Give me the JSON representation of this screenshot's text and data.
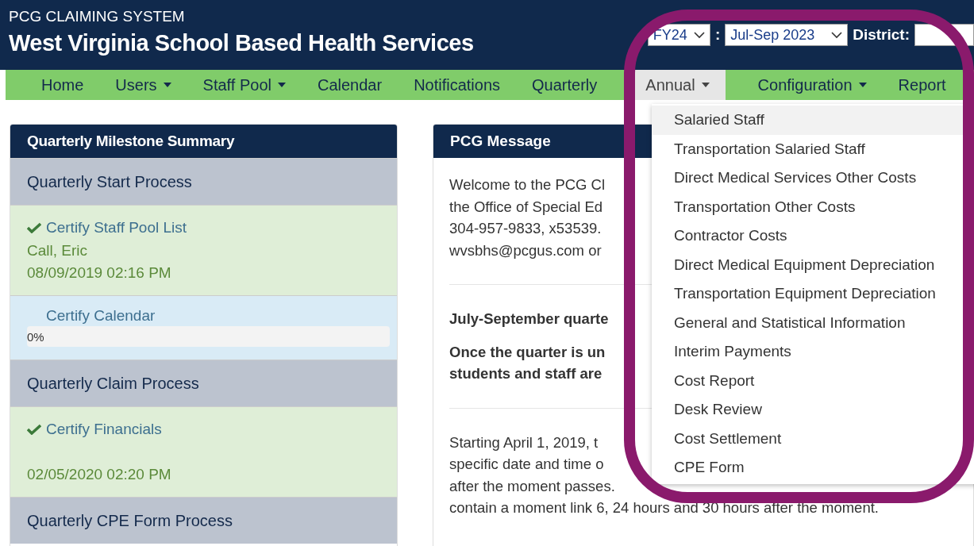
{
  "header": {
    "system": "PCG CLAIMING SYSTEM",
    "title": "West Virginia School Based Health Services",
    "fiscal_year": "FY24",
    "separator": ":",
    "quarter": "Jul-Sep 2023",
    "district_label": "District:"
  },
  "nav": [
    {
      "label": "Home",
      "has_menu": false,
      "selected": false
    },
    {
      "label": "Users",
      "has_menu": true,
      "selected": false
    },
    {
      "label": "Staff Pool",
      "has_menu": true,
      "selected": false
    },
    {
      "label": "Calendar",
      "has_menu": false,
      "selected": false
    },
    {
      "label": "Notifications",
      "has_menu": false,
      "selected": false
    },
    {
      "label": "Quarterly",
      "has_menu": false,
      "selected": false
    },
    {
      "label": "Annual",
      "has_menu": true,
      "selected": true
    },
    {
      "label": "Configuration",
      "has_menu": true,
      "selected": false
    },
    {
      "label": "Report",
      "has_menu": false,
      "selected": false
    }
  ],
  "annual_menu": [
    {
      "label": "Salaried Staff",
      "selected": true
    },
    {
      "label": "Transportation Salaried Staff",
      "selected": false
    },
    {
      "label": "Direct Medical Services Other Costs",
      "selected": false
    },
    {
      "label": "Transportation Other Costs",
      "selected": false
    },
    {
      "label": "Contractor Costs",
      "selected": false
    },
    {
      "label": "Direct Medical Equipment Depreciation",
      "selected": false
    },
    {
      "label": "Transportation Equipment Depreciation",
      "selected": false
    },
    {
      "label": "General and Statistical Information",
      "selected": false
    },
    {
      "label": "Interim Payments",
      "selected": false
    },
    {
      "label": "Cost Report",
      "selected": false
    },
    {
      "label": "Desk Review",
      "selected": false
    },
    {
      "label": "Cost Settlement",
      "selected": false
    },
    {
      "label": "CPE Form",
      "selected": false
    }
  ],
  "milestones": {
    "title": "Quarterly Milestone Summary",
    "items": [
      {
        "kind": "header",
        "label": "Quarterly Start Process"
      },
      {
        "kind": "done",
        "label": "Certify Staff Pool List",
        "person": "Call, Eric",
        "date": "08/09/2019 02:16 PM"
      },
      {
        "kind": "progress",
        "label": "Certify Calendar",
        "level": 0,
        "reading": "0%"
      },
      {
        "kind": "header",
        "label": "Quarterly Claim Process"
      },
      {
        "kind": "done",
        "label": "Certify Financials",
        "date": "02/05/2020 02:20 PM"
      },
      {
        "kind": "header",
        "label": "Quarterly CPE Form Process"
      }
    ]
  },
  "message": {
    "title": "PCG Message",
    "blocks": [
      {
        "kind": "text",
        "lines": [
          "Welcome to the PCG Cl",
          "the Office of Special Ed",
          "304-957-9833, x53539.",
          "wvsbhs@pcgus.com or"
        ]
      },
      {
        "kind": "divider"
      },
      {
        "kind": "bold",
        "lines": [
          "July-September quarte"
        ]
      },
      {
        "kind": "bold",
        "lines": [
          "Once the quarter is un",
          "students and staff are"
        ]
      },
      {
        "kind": "divider"
      },
      {
        "kind": "text",
        "lines": [
          "Starting April 1, 2019, t",
          "specific date and time o",
          "after the moment passes.",
          "contain a moment link 6, 24 hours and 30 hours after the moment."
        ]
      }
    ]
  }
}
